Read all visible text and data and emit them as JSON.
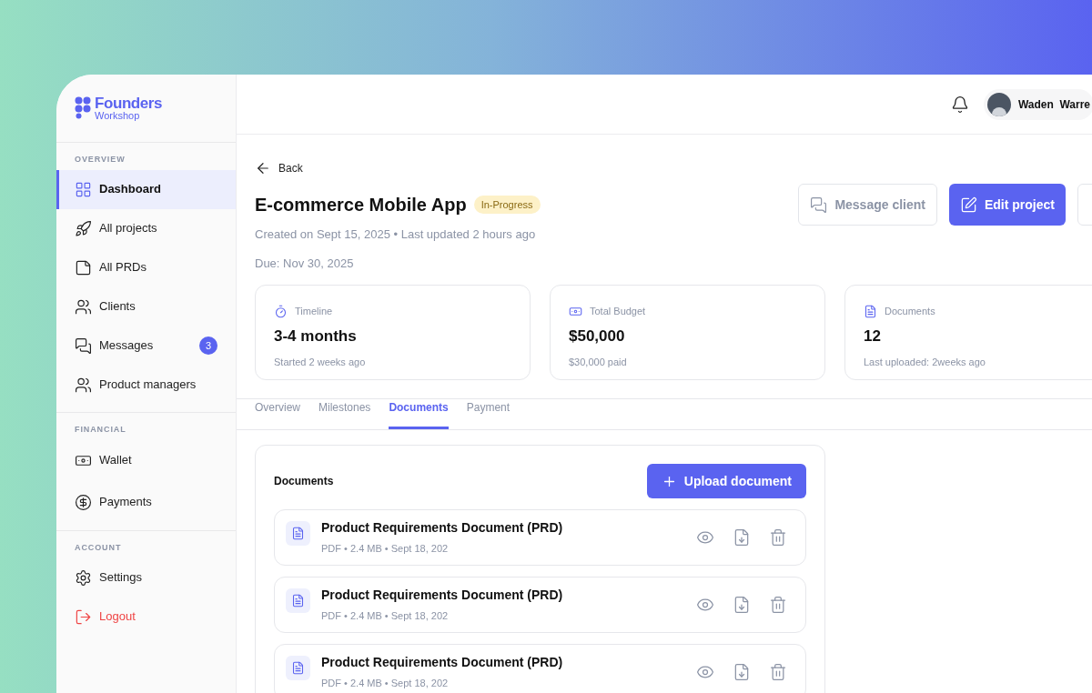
{
  "logo": {
    "line1": "Founders",
    "line2": "Workshop"
  },
  "sidebar": {
    "sections": [
      {
        "title": "OVERVIEW",
        "items": [
          {
            "label": "Dashboard",
            "selected": true,
            "kind": "normal"
          },
          {
            "label": "All projects",
            "selected": false,
            "kind": "normal"
          },
          {
            "label": "All PRDs",
            "selected": false,
            "kind": "normal"
          },
          {
            "label": "Clients",
            "selected": false,
            "kind": "normal"
          },
          {
            "label": "Messages",
            "selected": false,
            "kind": "normal",
            "badge": "3"
          },
          {
            "label": "Product managers",
            "selected": false,
            "kind": "normal"
          }
        ]
      },
      {
        "title": "FINANCIAL",
        "items": [
          {
            "label": "Wallet",
            "selected": false,
            "kind": "normal"
          },
          {
            "label": "Payments",
            "selected": false,
            "kind": "normal"
          }
        ]
      },
      {
        "title": "ACCOUNT",
        "items": [
          {
            "label": "Settings",
            "selected": false,
            "kind": "normal"
          },
          {
            "label": "Logout",
            "selected": false,
            "kind": "danger"
          }
        ]
      }
    ]
  },
  "header": {
    "user_name": "Waden  Warre"
  },
  "back": "Back",
  "project": {
    "title": "E-commerce Mobile App",
    "status": "In-Progress",
    "meta": "Created on Sept 15, 2025 • Last updated 2 hours ago",
    "due": "Due: Nov 30, 2025"
  },
  "actions": [
    {
      "label": "Message client",
      "kind": "secondary"
    },
    {
      "label": "Edit project",
      "kind": "primary"
    },
    {
      "kind": "outline"
    }
  ],
  "stats": [
    {
      "label": "Timeline",
      "value": "3-4 months",
      "sub": "Started 2 weeks ago"
    },
    {
      "label": "Total Budget",
      "value": "$50,000",
      "sub": "$30,000 paid"
    },
    {
      "label": "Documents",
      "value": "12",
      "sub": "Last uploaded: 2weeks ago"
    }
  ],
  "tabs": [
    {
      "label": "Overview",
      "selected": false
    },
    {
      "label": "Milestones",
      "selected": false
    },
    {
      "label": "Documents",
      "selected": true
    },
    {
      "label": "Payment",
      "selected": false
    }
  ],
  "documents": {
    "title": "Documents",
    "upload_button": "Upload document",
    "files": [
      {
        "name": "Product Requirements Document (PRD)",
        "meta": "PDF • 2.4 MB • Sept 18, 202"
      },
      {
        "name": "Product Requirements Document (PRD)",
        "meta": "PDF • 2.4 MB • Sept 18, 202"
      },
      {
        "name": "Product Requirements Document (PRD)",
        "meta": "PDF • 2.4 MB • Sept 18, 202"
      }
    ]
  }
}
